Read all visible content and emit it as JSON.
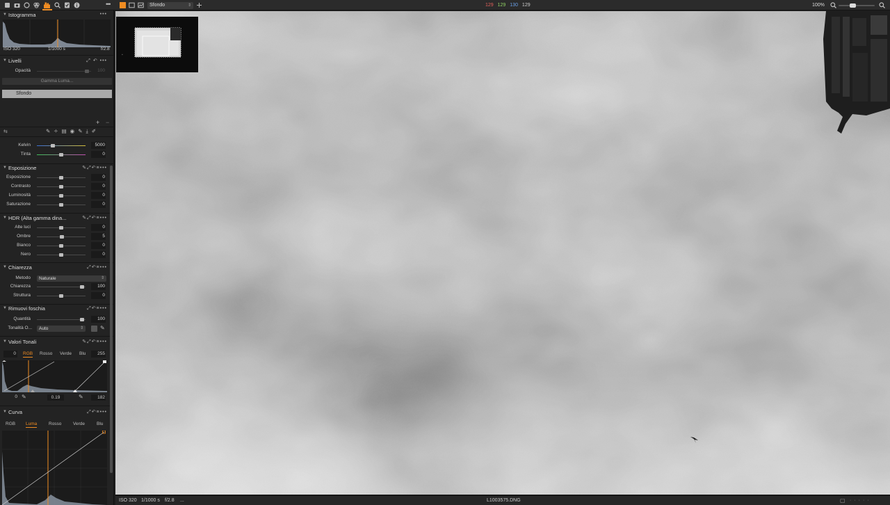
{
  "toolbar": {
    "variant_select": "Sfondo",
    "readout": {
      "r": "129",
      "g": "129",
      "b": "130",
      "l": "129"
    },
    "readout_colors": {
      "r": "#e0605a",
      "g": "#8fcf62",
      "b": "#6aa0e8",
      "l": "#cccccc"
    },
    "zoom": "100%",
    "zoom_level": 0.3,
    "tools": [
      "library-icon",
      "camera-icon",
      "lens-icon",
      "color-icon",
      "exposure-icon",
      "details-icon",
      "metadata-icon",
      "info-icon"
    ],
    "view_icons": [
      "grid-view-icon",
      "viewer-icon",
      "compare-icon",
      "add-variant-icon"
    ]
  },
  "histogram": {
    "title": "Istogramma",
    "iso": "ISO 320",
    "shutter": "1/1000 s",
    "aperture": "f/2.8"
  },
  "layers": {
    "title": "Livelli",
    "opacity_label": "Opacità",
    "opacity_value": "100",
    "gamma_button": "Gamma Luma...",
    "layer_name": "Sfondo"
  },
  "white_balance": {
    "rows": [
      {
        "label": "Kelvin",
        "value": "5000",
        "level": 0.33
      },
      {
        "label": "Tinta",
        "value": "0",
        "level": 0.5
      }
    ]
  },
  "exposure": {
    "title": "Esposizione",
    "rows": [
      {
        "label": "Esposizione",
        "value": "0",
        "level": 0.5
      },
      {
        "label": "Contrasto",
        "value": "0",
        "level": 0.5
      },
      {
        "label": "Luminosità",
        "value": "0",
        "level": 0.5
      },
      {
        "label": "Saturazione",
        "value": "0",
        "level": 0.5
      }
    ]
  },
  "hdr": {
    "title": "HDR (Alta gamma dina...",
    "rows": [
      {
        "label": "Alte luci",
        "value": "0",
        "level": 0.5
      },
      {
        "label": "Ombre",
        "value": "5",
        "level": 0.52
      },
      {
        "label": "Bianco",
        "value": "0",
        "level": 0.5
      },
      {
        "label": "Nero",
        "value": "0",
        "level": 0.5
      }
    ]
  },
  "clarity": {
    "title": "Chiarezza",
    "method_label": "Metodo",
    "method_value": "Naturale",
    "rows": [
      {
        "label": "Chiarezza",
        "value": "100",
        "level": 0.93
      },
      {
        "label": "Struttura",
        "value": "0",
        "level": 0.5
      }
    ]
  },
  "dehaze": {
    "title": "Rimuovi foschia",
    "amount_label": "Quantità",
    "amount_value": "100",
    "amount_level": 0.93,
    "tone_label": "Tonalità O...",
    "tone_value": "Auto"
  },
  "levels": {
    "title": "Valori Tonali",
    "tabs": [
      "RGB",
      "Rosso",
      "Verde",
      "Blu"
    ],
    "active_tab": 0,
    "input_low": "0",
    "input_high": "255",
    "output_low": "0",
    "midpoint": "0.19",
    "output_high": "182"
  },
  "curve": {
    "title": "Curva",
    "tabs": [
      "RGB",
      "Luma",
      "Rosso",
      "Verde",
      "Blu"
    ],
    "active_tab": 1
  },
  "status": {
    "iso": "ISO 320",
    "shutter": "1/1000 s",
    "aperture": "f/2.8",
    "more": "...",
    "filename": "L1003575.DNG"
  }
}
